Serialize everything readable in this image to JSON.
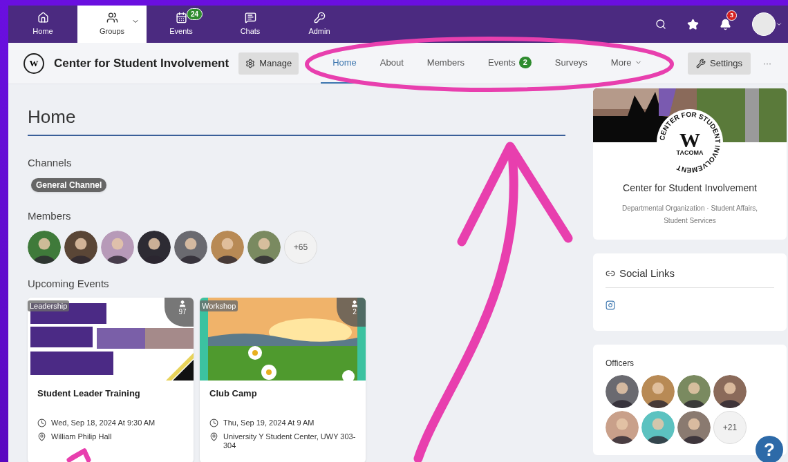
{
  "top_nav": {
    "items": [
      {
        "label": "Home",
        "selected": false
      },
      {
        "label": "Groups",
        "selected": true,
        "dropdown": true
      },
      {
        "label": "Events",
        "selected": false,
        "badge": "24"
      },
      {
        "label": "Chats",
        "selected": false
      },
      {
        "label": "Admin",
        "selected": false
      }
    ],
    "notifications_badge": "3"
  },
  "group_header": {
    "logo_text": "W",
    "title": "Center for Student Involvement",
    "manage": "Manage",
    "tabs": [
      {
        "label": "Home",
        "selected": true
      },
      {
        "label": "About",
        "selected": false
      },
      {
        "label": "Members",
        "selected": false
      },
      {
        "label": "Events",
        "selected": false,
        "badge": "2"
      },
      {
        "label": "Surveys",
        "selected": false
      },
      {
        "label": "More",
        "selected": false,
        "dropdown": true
      }
    ],
    "settings": "Settings",
    "more": "···"
  },
  "page_title": "Home",
  "channels": {
    "heading": "Channels",
    "items": [
      "General Channel"
    ]
  },
  "members": {
    "heading": "Members",
    "more": "+65"
  },
  "upcoming_events": {
    "heading": "Upcoming Events",
    "events": [
      {
        "category": "Leadership",
        "attendees": "97",
        "title": "Student Leader Training",
        "date": "Wed, Sep 18, 2024 At 9:30 AM",
        "location": "William Philip Hall"
      },
      {
        "category": "Workshop",
        "attendees": "2",
        "title": "Club Camp",
        "date": "Thu, Sep 19, 2024 At 9 AM",
        "location": "University Y Student Center, UWY 303-304"
      }
    ]
  },
  "profile_card": {
    "logo": {
      "ring_text": "CENTER FOR STUDENT INVOLVEMENT",
      "letter": "W",
      "place": "TACOMA"
    },
    "name": "Center for Student Involvement",
    "description": "Departmental Organization · Student Affairs, Student Services"
  },
  "social_links": {
    "heading": "Social Links"
  },
  "officers": {
    "heading": "Officers",
    "more": "+21"
  },
  "help_button": "?"
}
